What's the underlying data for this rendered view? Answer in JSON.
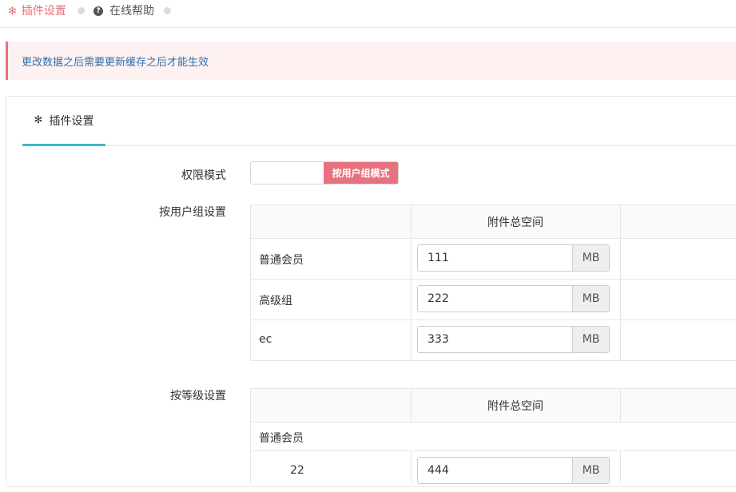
{
  "top_tabs": {
    "plugin_settings": "插件设置",
    "online_help": "在线帮助"
  },
  "alert": {
    "message": "更改数据之后需要更新缓存之后才能生效"
  },
  "panel": {
    "tab_label": "插件设置"
  },
  "form": {
    "permission_mode_label": "权限模式",
    "permission_mode_value": "按用户组模式",
    "by_group_label": "按用户组设置",
    "by_level_label": "按等级设置"
  },
  "group_table": {
    "header": "附件总空间",
    "unit": "MB",
    "rows": [
      {
        "name": "普通会员",
        "value": "111"
      },
      {
        "name": "高级组",
        "value": "222"
      },
      {
        "name": "ec",
        "value": "333"
      }
    ]
  },
  "level_table": {
    "header": "附件总空间",
    "unit": "MB",
    "group_name": "普通会员",
    "rows": [
      {
        "level": "22",
        "value": "444"
      }
    ]
  },
  "colors": {
    "accent": "#e8717f",
    "tab_underline": "#3cb9c7",
    "alert_text": "#2f6fb0"
  }
}
